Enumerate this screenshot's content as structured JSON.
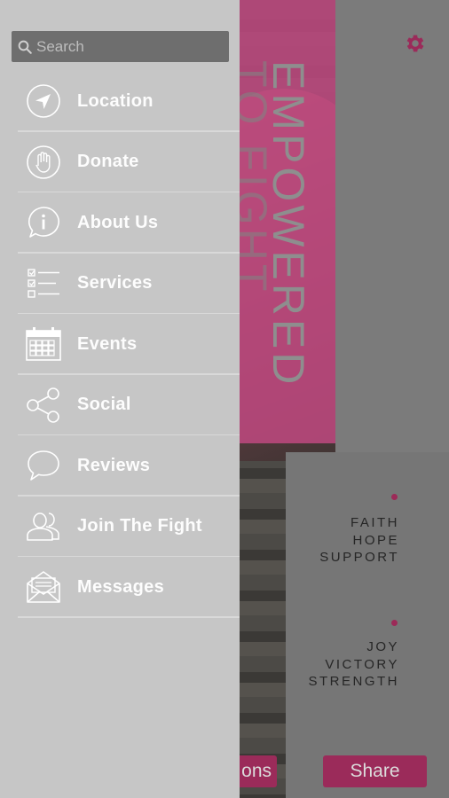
{
  "background": {
    "hero_text": "EMPOWERED",
    "hero_text_behind": "TO FIGHT",
    "settings_icon": "gear-icon",
    "words_top": [
      "FAITH",
      "HOPE",
      "SUPPORT"
    ],
    "words_bottom": [
      "JOY",
      "VICTORY",
      "STRENGTH"
    ],
    "left_button_label": "ons",
    "share_button_label": "Share",
    "accent": "#9b2b5a"
  },
  "drawer": {
    "search": {
      "placeholder": "Search",
      "value": ""
    },
    "items": [
      {
        "label": "Location",
        "icon": "location-arrow-icon"
      },
      {
        "label": "Donate",
        "icon": "hand-icon"
      },
      {
        "label": "About Us",
        "icon": "info-bubble-icon"
      },
      {
        "label": "Services",
        "icon": "checklist-icon"
      },
      {
        "label": "Events",
        "icon": "calendar-icon"
      },
      {
        "label": "Social",
        "icon": "share-nodes-icon"
      },
      {
        "label": "Reviews",
        "icon": "speech-bubble-icon"
      },
      {
        "label": "Join The Fight",
        "icon": "users-icon"
      },
      {
        "label": "Messages",
        "icon": "envelope-icon"
      }
    ]
  }
}
